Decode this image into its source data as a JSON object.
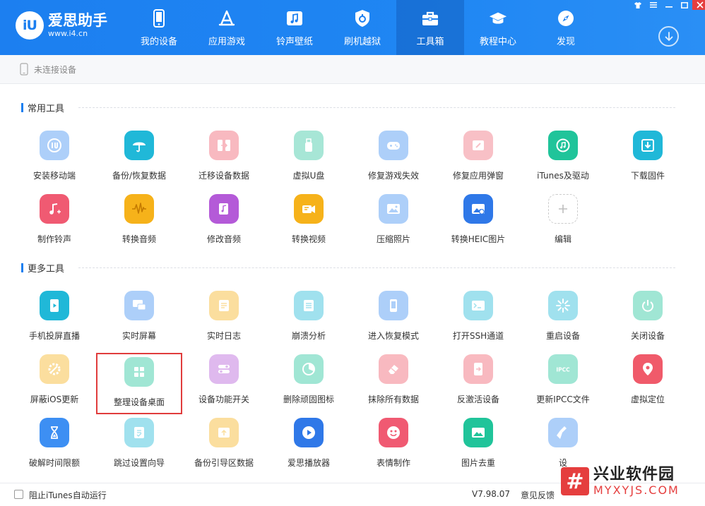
{
  "window": {
    "controls": [
      "shirt-icon",
      "menu-icon",
      "minimize-icon",
      "maximize-icon",
      "close-icon"
    ]
  },
  "header": {
    "logo": {
      "badge": "iU",
      "name": "爱思助手",
      "url": "www.i4.cn"
    },
    "nav": [
      {
        "label": "我的设备",
        "icon": "phone-icon"
      },
      {
        "label": "应用游戏",
        "icon": "appstore-icon"
      },
      {
        "label": "铃声壁纸",
        "icon": "music-note-icon"
      },
      {
        "label": "刷机越狱",
        "icon": "shield-icon"
      },
      {
        "label": "工具箱",
        "icon": "toolbox-icon",
        "active": true
      },
      {
        "label": "教程中心",
        "icon": "graduation-cap-icon"
      },
      {
        "label": "发现",
        "icon": "compass-icon"
      }
    ],
    "colors": {
      "primary": "#1c7ff0"
    }
  },
  "device_bar": {
    "status": "未连接设备"
  },
  "sections": {
    "common": {
      "title": "常用工具"
    },
    "more": {
      "title": "更多工具"
    }
  },
  "tools": {
    "common": [
      {
        "label": "安装移动端",
        "icon": "i4-logo-icon",
        "color": "#3d8ff3",
        "faded": true
      },
      {
        "label": "备份/恢复数据",
        "icon": "umbrella-icon",
        "color": "#20b8d8",
        "faded": false
      },
      {
        "label": "迁移设备数据",
        "icon": "transfer-icon",
        "color": "#f05a6a",
        "faded": true
      },
      {
        "label": "虚拟U盘",
        "icon": "usb-drive-icon",
        "color": "#2fc4a0",
        "faded": true
      },
      {
        "label": "修复游戏失效",
        "icon": "gamepad-icon",
        "color": "#3d8ff3",
        "faded": true
      },
      {
        "label": "修复应用弹窗",
        "icon": "repair-app-icon",
        "color": "#f06a7a",
        "faded": true
      },
      {
        "label": "iTunes及驱动",
        "icon": "itunes-icon",
        "color": "#20c49a",
        "faded": false
      },
      {
        "label": "下载固件",
        "icon": "download-firmware-icon",
        "color": "#20b8d8",
        "faded": false
      },
      {
        "label": "制作铃声",
        "icon": "ringtone-icon",
        "color": "#f05a72",
        "faded": false
      },
      {
        "label": "转换音频",
        "icon": "waveform-icon",
        "color": "#f6b21a",
        "faded": false
      },
      {
        "label": "修改音频",
        "icon": "audio-edit-icon",
        "color": "#b45ad8",
        "faded": false
      },
      {
        "label": "转换视频",
        "icon": "video-icon",
        "color": "#f6b21a",
        "faded": false
      },
      {
        "label": "压缩照片",
        "icon": "photo-icon",
        "color": "#3d8ff3",
        "faded": true
      },
      {
        "label": "转换HEIC图片",
        "icon": "heic-icon",
        "color": "#2f78e8",
        "faded": false
      },
      {
        "label": "编辑",
        "icon": "plus-icon",
        "color": "#cccccc",
        "faded": false,
        "outline": true
      }
    ],
    "more": [
      {
        "label": "手机投屏直播",
        "icon": "screen-cast-icon",
        "color": "#20b8d8",
        "faded": false
      },
      {
        "label": "实时屏幕",
        "icon": "realtime-screen-icon",
        "color": "#3d8ff3",
        "faded": true
      },
      {
        "label": "实时日志",
        "icon": "log-icon",
        "color": "#f6b21a",
        "faded": true
      },
      {
        "label": "崩溃分析",
        "icon": "crash-report-icon",
        "color": "#20b8d8",
        "faded": true
      },
      {
        "label": "进入恢复模式",
        "icon": "recovery-mode-icon",
        "color": "#3d8ff3",
        "faded": true
      },
      {
        "label": "打开SSH通道",
        "icon": "terminal-icon",
        "color": "#20b8d8",
        "faded": true
      },
      {
        "label": "重启设备",
        "icon": "restart-icon",
        "color": "#20b8d8",
        "faded": true
      },
      {
        "label": "关闭设备",
        "icon": "power-icon",
        "color": "#20c49a",
        "faded": true
      },
      {
        "label": "屏蔽iOS更新",
        "icon": "gear-block-icon",
        "color": "#f6b21a",
        "faded": true
      },
      {
        "label": "整理设备桌面",
        "icon": "grid-icon",
        "color": "#20c49a",
        "faded": true,
        "highlight": true
      },
      {
        "label": "设备功能开关",
        "icon": "toggle-icon",
        "color": "#b45ad8",
        "faded": true
      },
      {
        "label": "删除顽固图标",
        "icon": "pie-icon",
        "color": "#20c49a",
        "faded": true
      },
      {
        "label": "抹除所有数据",
        "icon": "eraser-icon",
        "color": "#f05a6a",
        "faded": true
      },
      {
        "label": "反激活设备",
        "icon": "deactivate-icon",
        "color": "#f05a6a",
        "faded": true
      },
      {
        "label": "更新IPCC文件",
        "icon": "ipcc-icon",
        "color": "#20c49a",
        "faded": true
      },
      {
        "label": "虚拟定位",
        "icon": "location-pin-icon",
        "color": "#f05a6a",
        "faded": false
      },
      {
        "label": "破解时间限额",
        "icon": "hourglass-icon",
        "color": "#3d8ff3",
        "faded": false
      },
      {
        "label": "跳过设置向导",
        "icon": "skip-setup-icon",
        "color": "#20b8d8",
        "faded": true
      },
      {
        "label": "备份引导区数据",
        "icon": "backup-boot-icon",
        "color": "#f6b21a",
        "faded": true
      },
      {
        "label": "爱思播放器",
        "icon": "play-icon",
        "color": "#2f78e8",
        "faded": false
      },
      {
        "label": "表情制作",
        "icon": "emoji-icon",
        "color": "#f05a72",
        "faded": false
      },
      {
        "label": "图片去重",
        "icon": "photo-dedup-icon",
        "color": "#20c49a",
        "faded": false
      },
      {
        "label": "设",
        "icon": "clean-brush-icon",
        "color": "#3d8ff3",
        "faded": true
      }
    ]
  },
  "footer": {
    "itunes_checkbox_label": "阻止iTunes自动运行",
    "version": "V7.98.07",
    "feedback": "意见反馈"
  },
  "watermark": {
    "badge": "#",
    "name": "兴业软件园",
    "url": "MYXYJS.COM"
  }
}
